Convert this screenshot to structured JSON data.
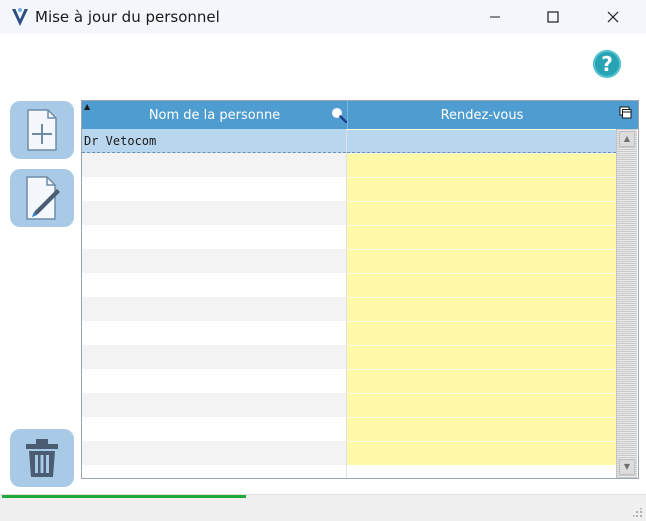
{
  "window": {
    "title": "Mise à jour du personnel",
    "help_label": "?"
  },
  "grid": {
    "columns": [
      "Nom de la personne",
      "Rendez-vous"
    ],
    "rows": [
      {
        "name": "Dr Vetocom",
        "rdv": "",
        "selected": true
      },
      {
        "name": "",
        "rdv": ""
      },
      {
        "name": "",
        "rdv": ""
      },
      {
        "name": "",
        "rdv": ""
      },
      {
        "name": "",
        "rdv": ""
      },
      {
        "name": "",
        "rdv": ""
      },
      {
        "name": "",
        "rdv": ""
      },
      {
        "name": "",
        "rdv": ""
      },
      {
        "name": "",
        "rdv": ""
      },
      {
        "name": "",
        "rdv": ""
      },
      {
        "name": "",
        "rdv": ""
      },
      {
        "name": "",
        "rdv": ""
      },
      {
        "name": "",
        "rdv": ""
      },
      {
        "name": "",
        "rdv": ""
      }
    ],
    "row_colors": {
      "stripe": "#f3f3f3",
      "plain": "#ffffff",
      "rdv": "#fdf9a8",
      "selected": "#b8d7ee",
      "header": "#4f9cd0"
    }
  },
  "status": {
    "progress": 0.38,
    "progress_color": "#1fa83a"
  },
  "icons": {
    "app": "vetocom-logo-icon",
    "add": "add-document-icon",
    "edit": "edit-document-icon",
    "delete": "trash-icon",
    "search": "search-icon"
  }
}
